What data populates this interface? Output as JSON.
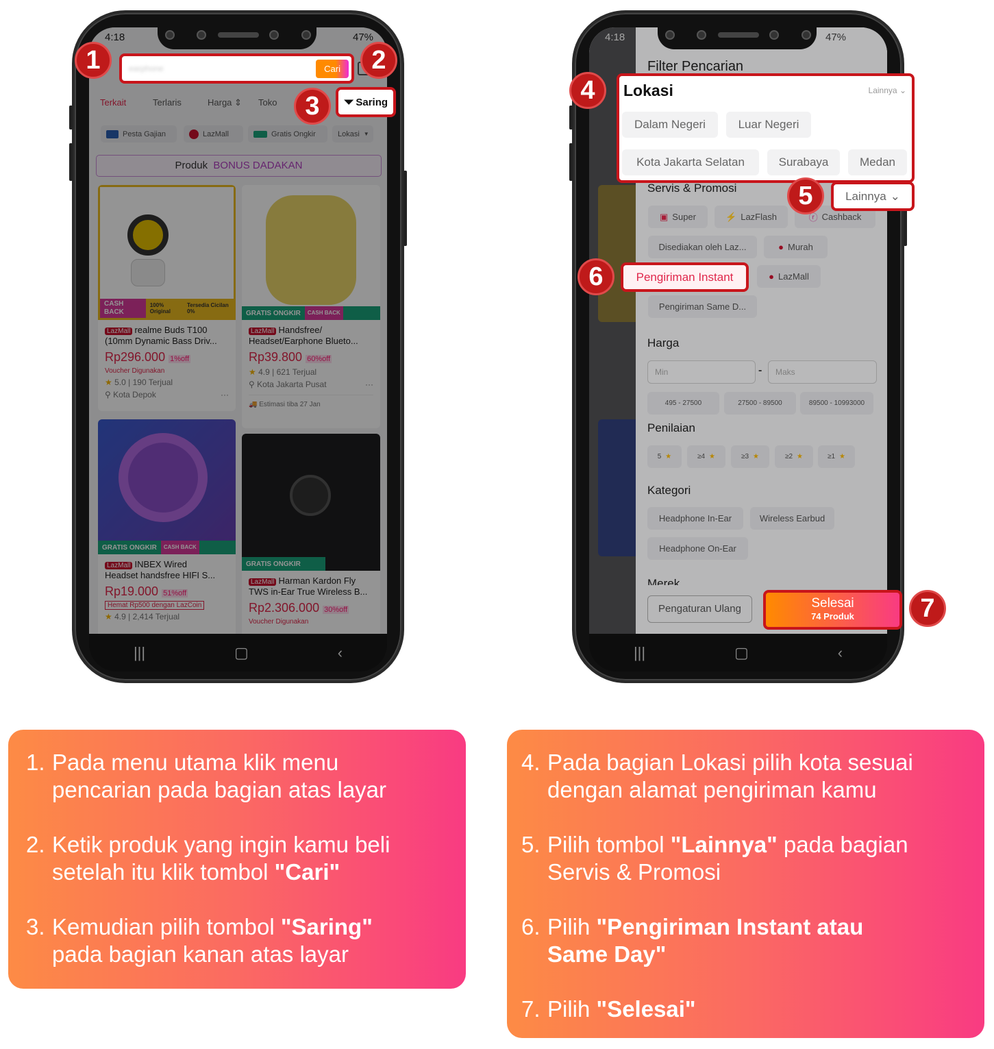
{
  "left_phone": {
    "status": {
      "time": "4:18",
      "battery": "47%"
    },
    "search": {
      "value": "earphone",
      "button": "Cari"
    },
    "sort_tabs": [
      "Terkait",
      "Terlaris",
      "Harga",
      "Toko"
    ],
    "filter_button": "Saring",
    "chips": [
      "Pesta Gajian",
      "LazMall",
      "Gratis Ongkir",
      "Lokasi"
    ],
    "banner": {
      "label": "Produk",
      "highlight": "BONUS DADAKAN"
    },
    "products": [
      {
        "badge": "LazMall",
        "title1": "realme Buds T100",
        "title2": "(10mm Dynamic Bass Driv...",
        "price": "Rp296.000",
        "discount": "1%off",
        "note": "Voucher Digunakan",
        "rating": "5.0",
        "sold": "190 Terjual",
        "location": "Kota Depok",
        "tags": [
          "CASH BACK",
          "100% Original",
          "Tersedia Cicilan 0%"
        ]
      },
      {
        "badge": "LazMall",
        "title1": "Handsfree/",
        "title2": "Headset/Earphone Blueto...",
        "price": "Rp39.800",
        "discount": "60%off",
        "rating": "4.9",
        "sold": "621 Terjual",
        "location": "Kota Jakarta Pusat",
        "eta": "Estimasi tiba 27 Jan",
        "tags": [
          "GRATIS ONGKIR",
          "CASH BACK"
        ]
      },
      {
        "badge": "LazMall",
        "title1": "INBEX Wired",
        "title2": "Headset handsfree HIFI S...",
        "price": "Rp19.000",
        "discount": "51%off",
        "note": "Hemat Rp500 dengan LazCoin",
        "rating": "4.9",
        "sold": "2,414 Terjual",
        "tags": [
          "GRATIS ONGKIR",
          "CASH BACK"
        ]
      },
      {
        "badge": "LazMall",
        "title1": "Harman Kardon Fly",
        "title2": "TWS in-Ear True Wireless B...",
        "price": "Rp2.306.000",
        "discount": "30%off",
        "note": "Voucher Digunakan",
        "tags": [
          "GRATIS ONGKIR"
        ]
      }
    ]
  },
  "right_phone": {
    "status": {
      "time": "4:18",
      "battery": "47%"
    },
    "title": "Filter Pencarian",
    "lokasi": {
      "title": "Lokasi",
      "more": "Lainnya",
      "options": [
        "Dalam Negeri",
        "Luar Negeri",
        "Kota Jakarta Selatan",
        "Surabaya",
        "Medan"
      ]
    },
    "servis": {
      "title": "Servis & Promosi",
      "more": "Lainnya",
      "options": [
        "Super",
        "LazFlash",
        "Cashback",
        "Disediakan oleh Laz...",
        "Murah",
        "Pengiriman Instant",
        "LazMall",
        "Pengiriman Same D..."
      ]
    },
    "harga": {
      "title": "Harga",
      "min_placeholder": "Min",
      "max_placeholder": "Maks",
      "ranges": [
        "495 - 27500",
        "27500 - 89500",
        "89500 - 10993000"
      ]
    },
    "penilaian": {
      "title": "Penilaian",
      "options": [
        "5",
        "≥4",
        "≥3",
        "≥2",
        "≥1"
      ]
    },
    "kategori": {
      "title": "Kategori",
      "options": [
        "Headphone In-Ear",
        "Wireless Earbud",
        "Headphone On-Ear"
      ]
    },
    "merek": {
      "title": "Merek"
    },
    "reset_button": "Pengaturan Ulang",
    "done_button": {
      "label": "Selesai",
      "count": "74 Produk"
    }
  },
  "markers": [
    "1",
    "2",
    "3",
    "4",
    "5",
    "6",
    "7"
  ],
  "colors": {
    "marker": "#bf1a1a",
    "gradient_start": "#fd8b45",
    "gradient_end": "#f93b82",
    "price": "#e0274b"
  },
  "instructions_left": [
    {
      "num": "1.",
      "line1": "Pada menu utama klik menu",
      "line2": "pencarian pada bagian atas layar"
    },
    {
      "num": "2.",
      "line1": "Ketik produk yang ingin kamu beli",
      "line2": "setelah itu klik tombol ",
      "bold": "\"Cari\""
    },
    {
      "num": "3.",
      "line1": "Kemudian pilih tombol ",
      "bold": "\"Saring\"",
      "line2": "pada bagian kanan atas layar"
    }
  ],
  "instructions_right": [
    {
      "num": "4.",
      "line1": "Pada bagian Lokasi pilih kota sesuai",
      "line2": "dengan alamat pengiriman kamu"
    },
    {
      "num": "5.",
      "line1": "Pilih tombol ",
      "bold": "\"Lainnya\"",
      "line1_end": " pada bagian",
      "line2": "Servis & Promosi"
    },
    {
      "num": "6.",
      "line1": "Pilih ",
      "bold": "\"Pengiriman Instant atau",
      "bold2": "Same Day\""
    },
    {
      "num": "7.",
      "line1": "Pilih ",
      "bold": "\"Selesai\""
    }
  ]
}
